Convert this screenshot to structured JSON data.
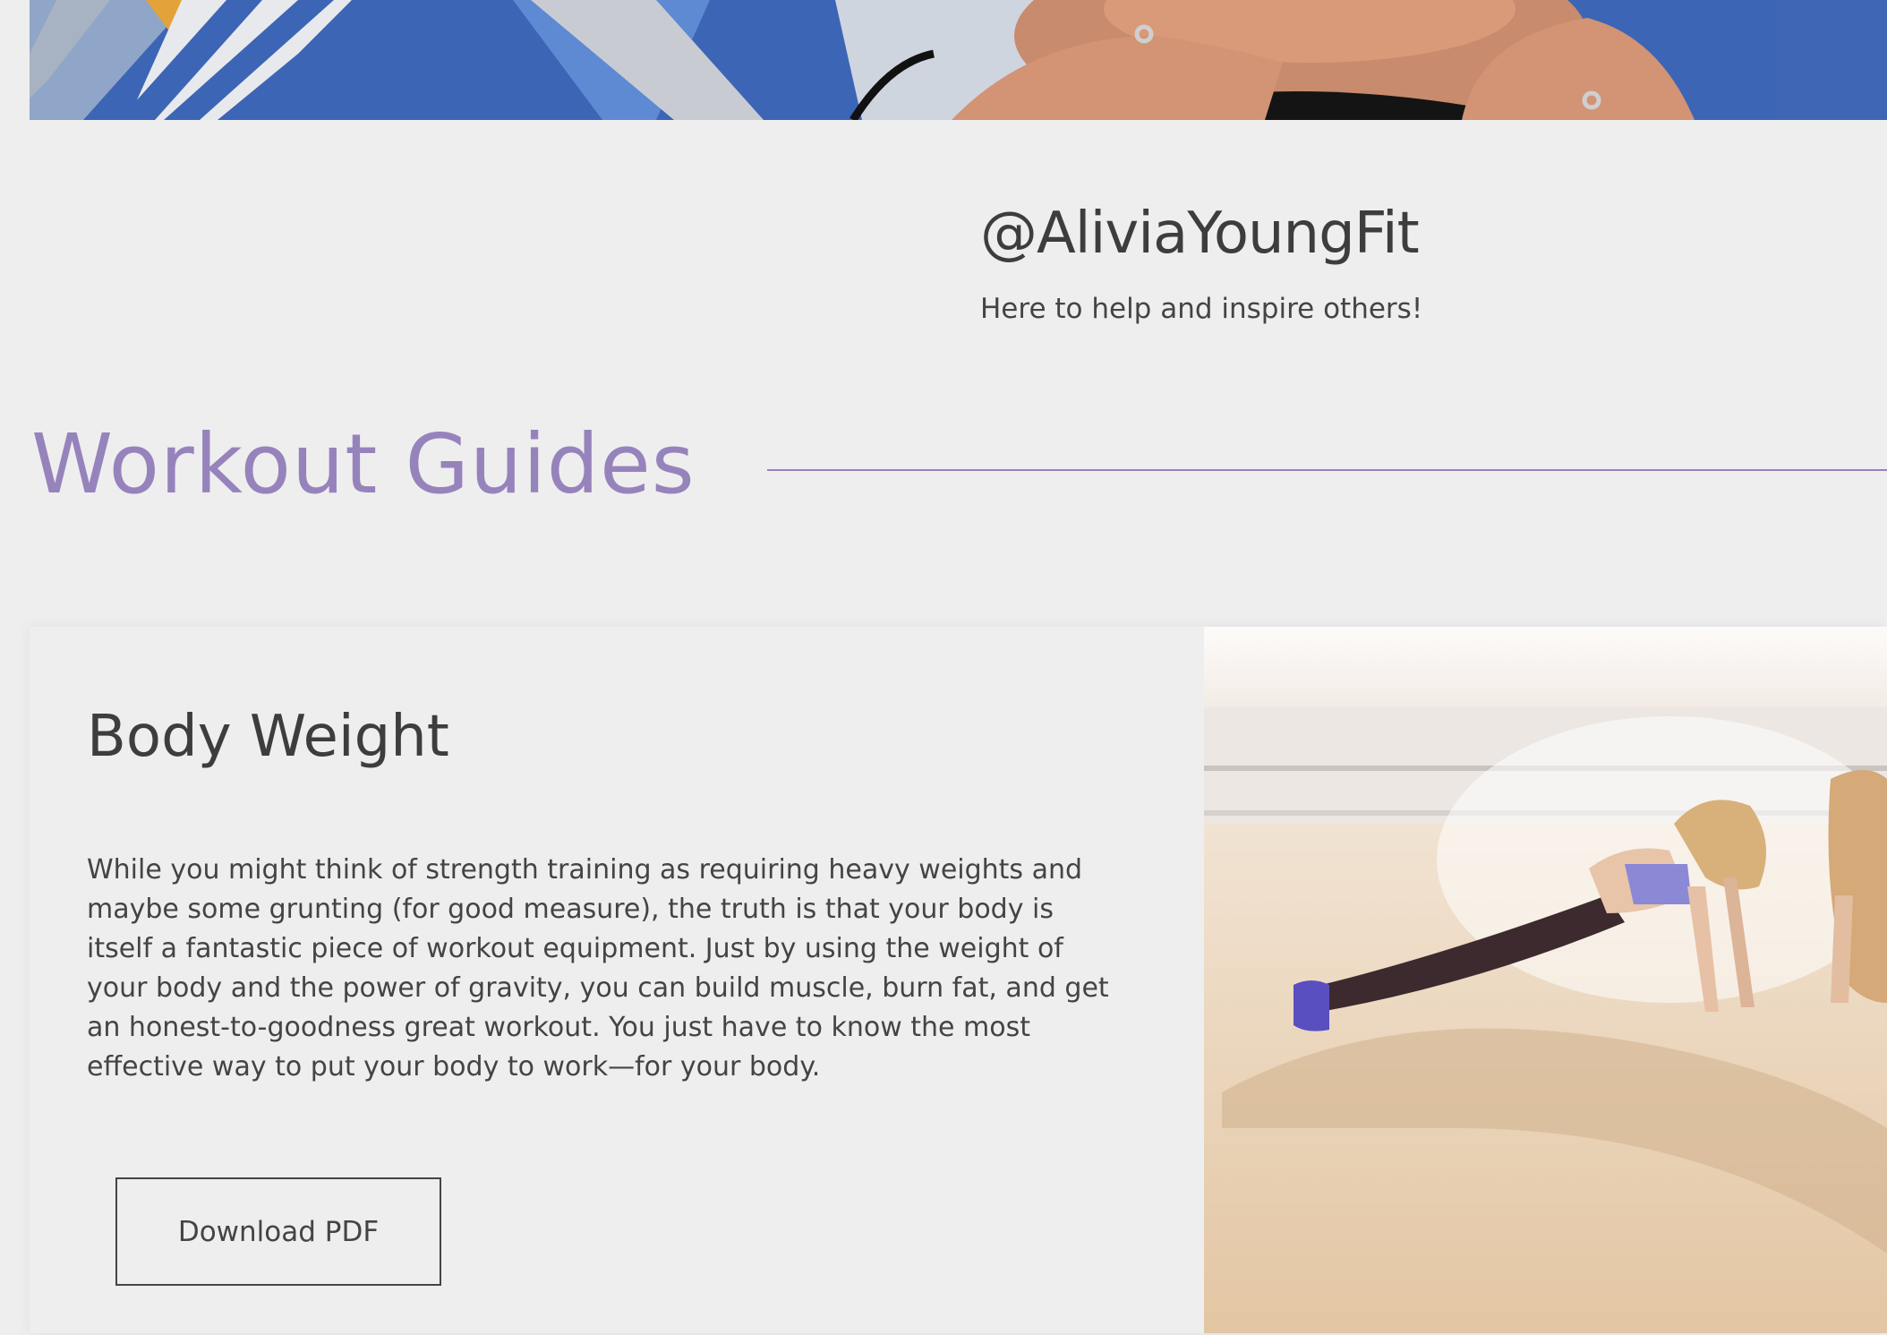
{
  "profile": {
    "handle": "@AliviaYoungFit",
    "tagline": "Here to help and inspire others!"
  },
  "section": {
    "title": "Workout Guides"
  },
  "guide": {
    "title": "Body Weight",
    "body": "While you might think of strength training as requiring heavy weights and maybe some grunting (for good measure), the truth is that your body is itself a fantastic piece of workout equipment. Just by using the weight of your body and the power of gravity, you can build muscle, burn fat, and get an honest-to-goodness great workout. You just have to know the most effective way to put your body to work—for your body.",
    "button_label": "Download PDF"
  },
  "colors": {
    "page_background": "#eeeeee",
    "accent": "#9683bc",
    "text": "#444444"
  }
}
